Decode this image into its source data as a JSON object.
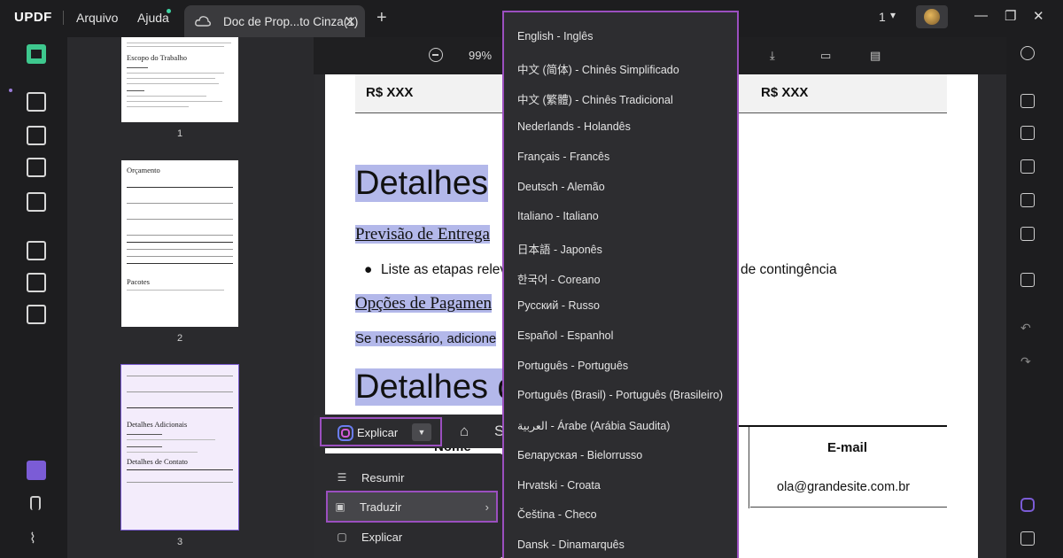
{
  "titlebar": {
    "logo": "UPDF",
    "menu_arquivo": "Arquivo",
    "menu_ajuda": "Ajuda",
    "tab_title": "Doc de Prop...to Cinza(1)",
    "page_count": "1"
  },
  "toolbar": {
    "zoom": "99%"
  },
  "thumbnails": [
    {
      "number": "1",
      "title": "Escopo do Trabalho"
    },
    {
      "number": "2",
      "title": "Orçamento",
      "section": "Pacotes"
    },
    {
      "number": "3",
      "title": "Detalhes Adicionais",
      "section": "Detalhes de Contato"
    }
  ],
  "document": {
    "price_left": "R$ XXX",
    "price_right": "R$ XXX",
    "heading1": "Detalhes ",
    "sub1": "Previsão de Entrega",
    "bullet1_start": "Liste as etapas relev",
    "bullet1_end": "de contingência",
    "sub2": "Opções de Pagamen",
    "body1": "Se necessário, adicione",
    "heading2": "Detalhes d",
    "col_name": "Nome",
    "col_email": "E-mail",
    "email_value": "ola@grandesite.com.br"
  },
  "selection_toolbar": {
    "explain_label": "Explicar",
    "dropdown_icon": "caret-down-icon"
  },
  "context_menu": {
    "items": [
      {
        "label": "Resumir",
        "icon": "list-icon"
      },
      {
        "label": "Traduzir",
        "icon": "translate-icon"
      },
      {
        "label": "Explicar",
        "icon": "explain-icon"
      }
    ]
  },
  "languages": [
    "English - Inglês",
    "中文 (简体) - Chinês Simplificado",
    "中文 (繁體) - Chinês Tradicional",
    "Nederlands - Holandês",
    "Français - Francês",
    "Deutsch - Alemão",
    "Italiano - Italiano",
    "日本語 - Japonês",
    "한국어 - Coreano",
    "Русский - Russo",
    "Español - Espanhol",
    "Português - Português",
    "Português (Brasil) - Português (Brasileiro)",
    "العربية - Árabe (Arábia Saudita)",
    "Беларуская - Bielorrusso",
    "Hrvatski - Croata",
    "Čeština - Checo",
    "Dansk - Dinamarquês"
  ],
  "colors": {
    "accent_purple": "#9b4fbf",
    "highlight": "#b3b8ea",
    "brand_green": "#3ec88e"
  }
}
